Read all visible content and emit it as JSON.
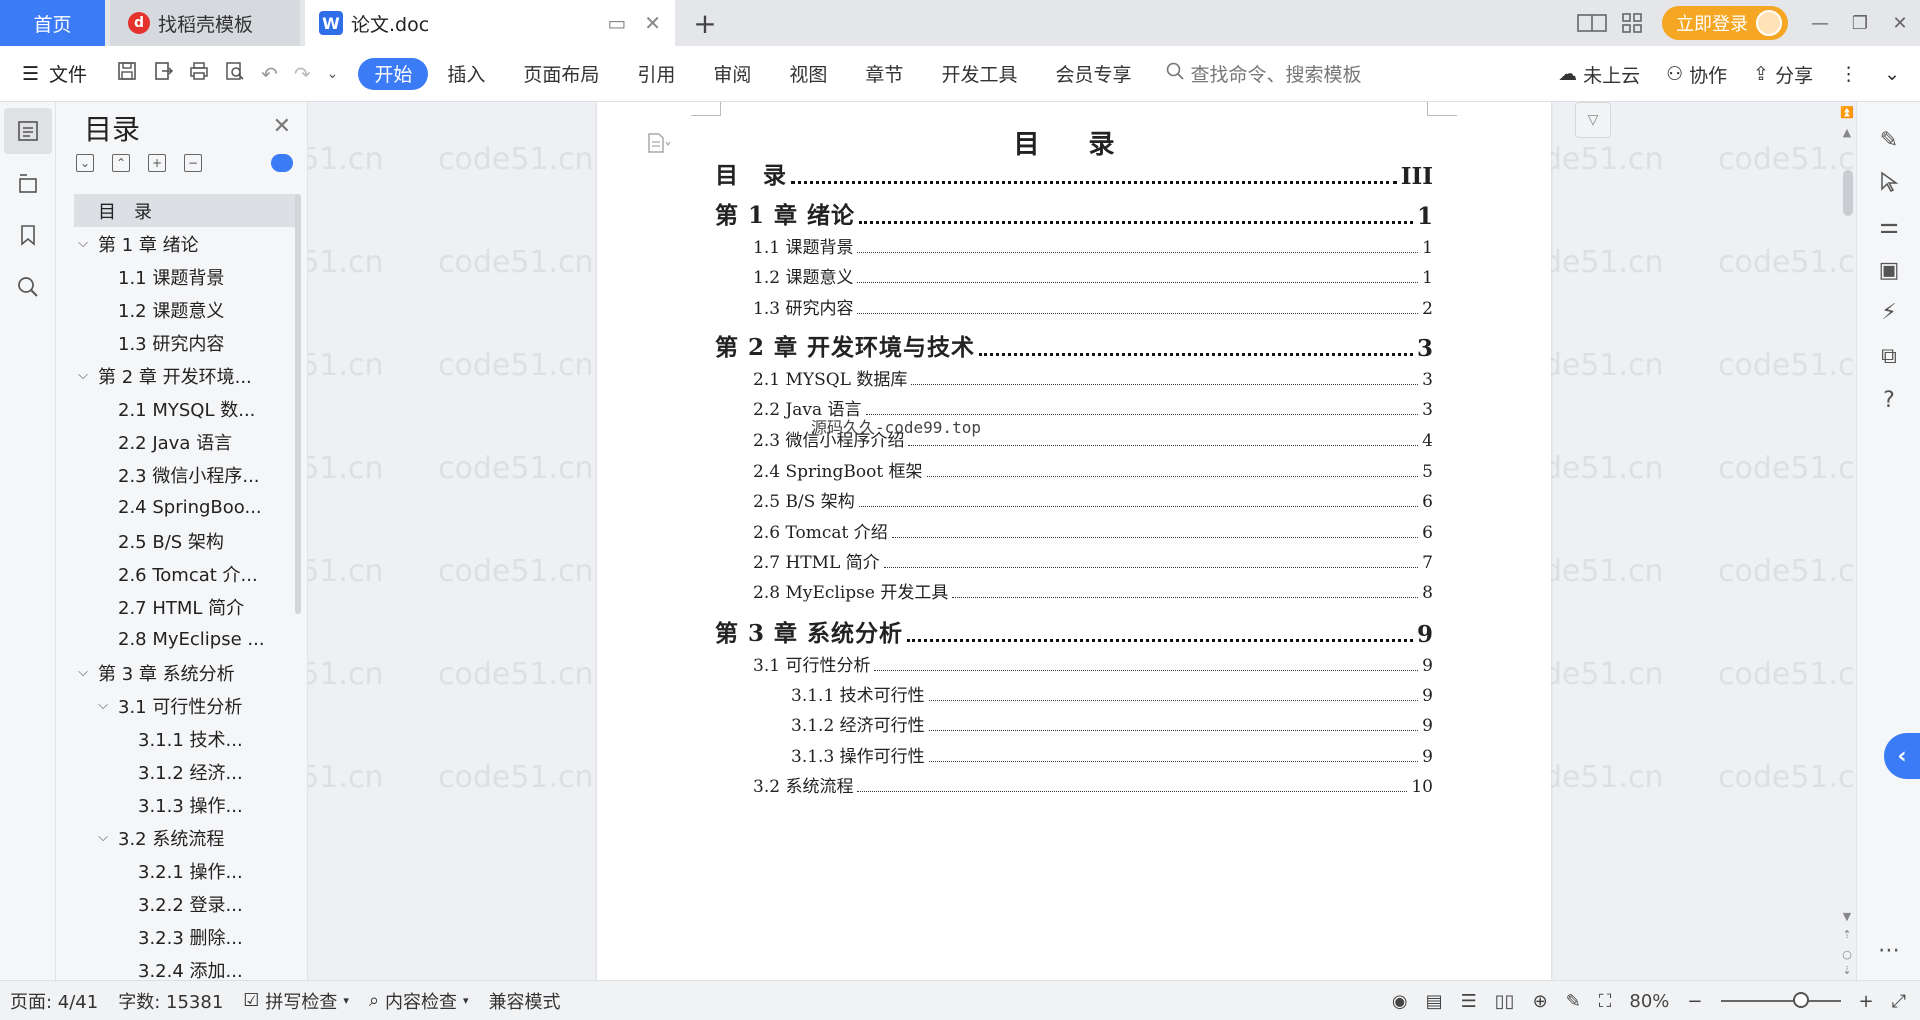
{
  "titlebar": {
    "tabs": [
      {
        "label": "首页"
      },
      {
        "label": "找稻壳模板",
        "icon": "daoke-logo-icon"
      },
      {
        "label": "论文.doc",
        "icon": "wps-writer-icon"
      }
    ],
    "login_label": "立即登录"
  },
  "ribbon": {
    "file_label": "文件",
    "tabs": [
      "开始",
      "插入",
      "页面布局",
      "引用",
      "审阅",
      "视图",
      "章节",
      "开发工具",
      "会员专享"
    ],
    "active_tab": "开始",
    "search_placeholder": "查找命令、搜索模板",
    "cloud_label": "未上云",
    "collab_label": "协作",
    "share_label": "分享"
  },
  "toc_panel": {
    "title": "目录",
    "items": [
      {
        "label": "目　录",
        "level": 0
      },
      {
        "label": "第 1 章  绪论",
        "level": 0
      },
      {
        "label": "1.1  课题背景",
        "level": 1
      },
      {
        "label": "1.2  课题意义",
        "level": 1
      },
      {
        "label": "1.3  研究内容",
        "level": 1
      },
      {
        "label": "第 2 章  开发环境...",
        "level": 0
      },
      {
        "label": "2.1 MYSQL 数...",
        "level": 1
      },
      {
        "label": "2.2 Java 语言",
        "level": 1
      },
      {
        "label": "2.3  微信小程序...",
        "level": 1
      },
      {
        "label": "2.4 SpringBoo...",
        "level": 1
      },
      {
        "label": "2.5 B/S 架构",
        "level": 1
      },
      {
        "label": "2.6 Tomcat 介...",
        "level": 1
      },
      {
        "label": "2.7 HTML 简介",
        "level": 1
      },
      {
        "label": "2.8 MyEclipse ...",
        "level": 1
      },
      {
        "label": "第 3 章  系统分析",
        "level": 0
      },
      {
        "label": "3.1  可行性分析",
        "level": 1
      },
      {
        "label": "3.1.1  技术...",
        "level": 2
      },
      {
        "label": "3.1.2  经济...",
        "level": 2
      },
      {
        "label": "3.1.3  操作...",
        "level": 2
      },
      {
        "label": "3.2  系统流程",
        "level": 1
      },
      {
        "label": "3.2.1  操作...",
        "level": 2
      },
      {
        "label": "3.2.2  登录...",
        "level": 2
      },
      {
        "label": "3.2.3  删除...",
        "level": 2
      },
      {
        "label": "3.2.4  添加...",
        "level": 2
      }
    ]
  },
  "document": {
    "heading": "目  录",
    "overlay_text": "源码久久-code99.top",
    "watermark": "code51.cn",
    "entries": [
      {
        "label": "目　录",
        "page": "III",
        "style": "top"
      },
      {
        "label": "第 1 章  绪论",
        "page": "1",
        "style": "top"
      },
      {
        "label": "1.1  课题背景",
        "page": "1",
        "style": "l2"
      },
      {
        "label": "1.2  课题意义",
        "page": "1",
        "style": "l2"
      },
      {
        "label": "1.3  研究内容",
        "page": "2",
        "style": "l2"
      },
      {
        "label": "第 2 章  开发环境与技术",
        "page": "3",
        "style": "top"
      },
      {
        "label": "2.1 MYSQL 数据库",
        "page": "3",
        "style": "l2"
      },
      {
        "label": "2.2 Java 语言",
        "page": "3",
        "style": "l2"
      },
      {
        "label": "2.3  微信小程序介绍",
        "page": "4",
        "style": "l2"
      },
      {
        "label": "2.4 SpringBoot 框架",
        "page": "5",
        "style": "l2"
      },
      {
        "label": "2.5 B/S 架构",
        "page": "6",
        "style": "l2"
      },
      {
        "label": "2.6 Tomcat 介绍",
        "page": "6",
        "style": "l2"
      },
      {
        "label": "2.7 HTML 简介",
        "page": "7",
        "style": "l2"
      },
      {
        "label": "2.8 MyEclipse 开发工具",
        "page": "8",
        "style": "l2"
      },
      {
        "label": "第 3 章  系统分析",
        "page": "9",
        "style": "top"
      },
      {
        "label": "3.1  可行性分析",
        "page": "9",
        "style": "l2"
      },
      {
        "label": "3.1.1  技术可行性",
        "page": "9",
        "style": "l3"
      },
      {
        "label": "3.1.2  经济可行性",
        "page": "9",
        "style": "l3"
      },
      {
        "label": "3.1.3  操作可行性",
        "page": "9",
        "style": "l3"
      },
      {
        "label": "3.2  系统流程",
        "page": "10",
        "style": "l2"
      }
    ]
  },
  "status": {
    "page_info": "页面: 4/41",
    "word_count": "字数: 15381",
    "spell_check": "拼写检查",
    "content_check": "内容检查",
    "compat_mode": "兼容模式",
    "zoom": "80%"
  }
}
